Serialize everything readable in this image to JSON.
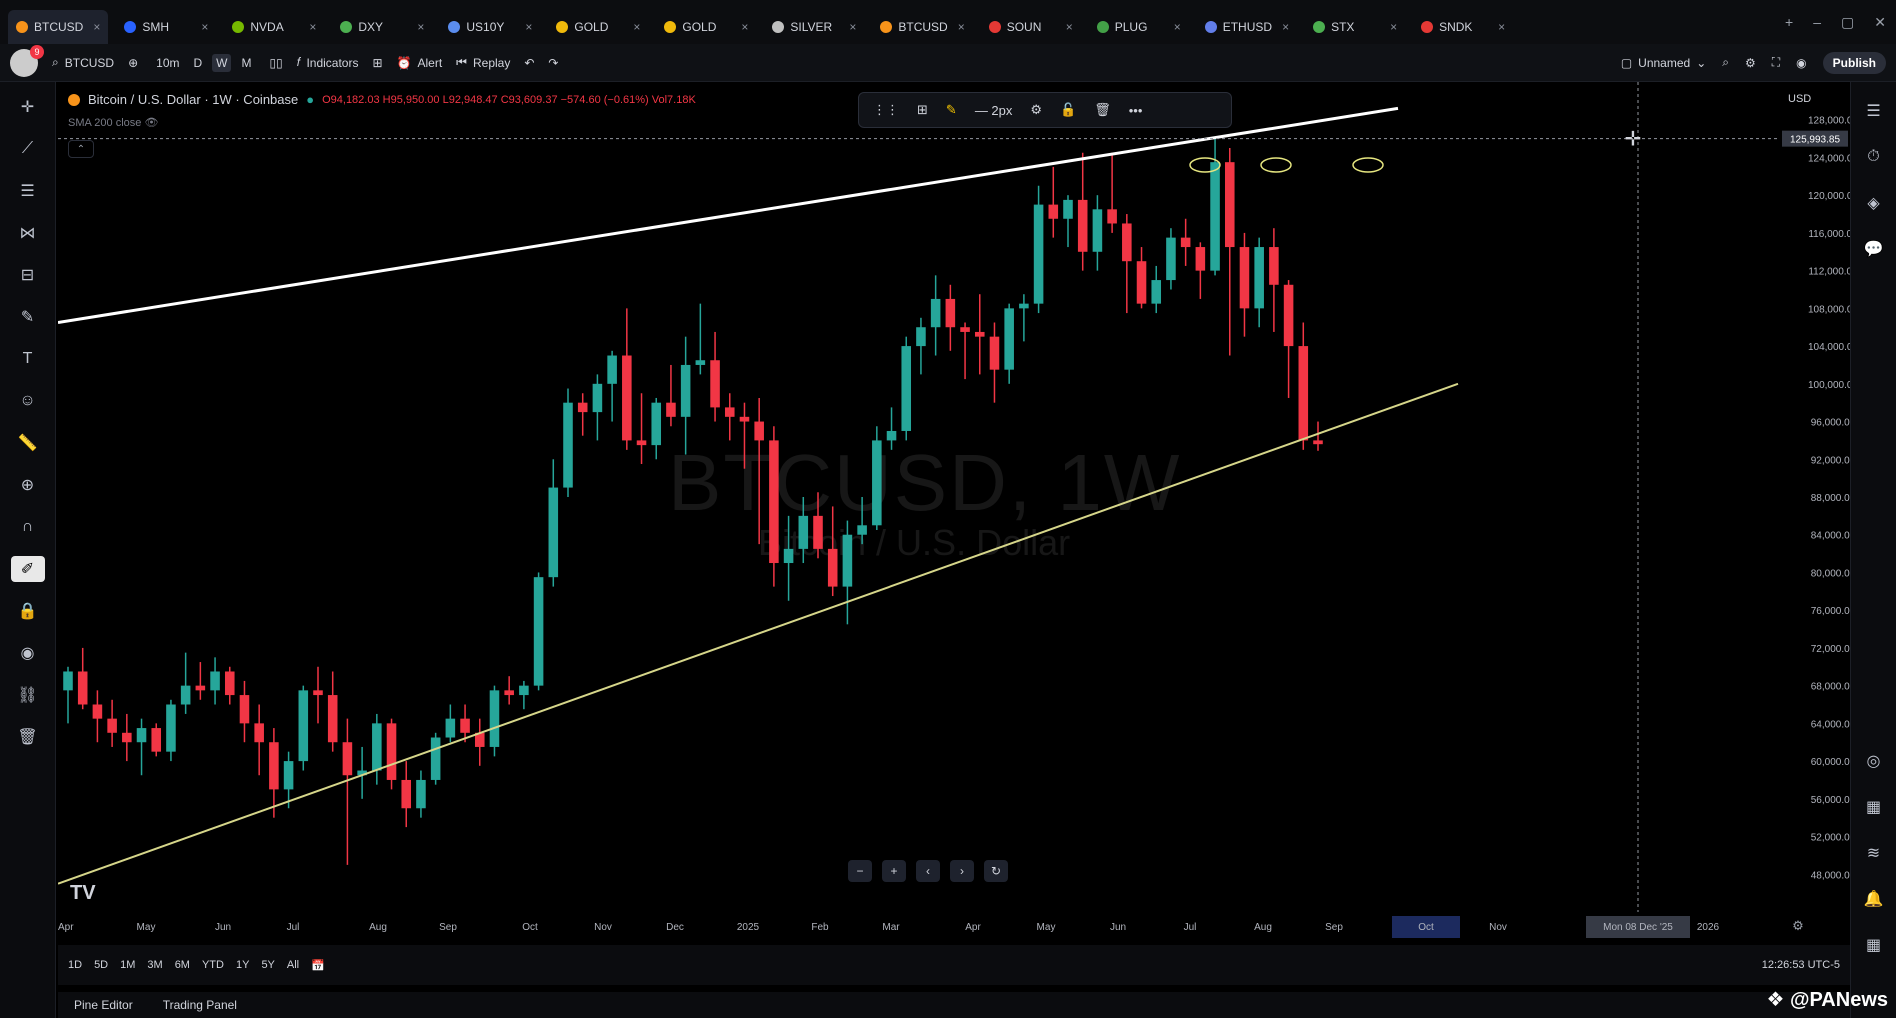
{
  "tabs": [
    {
      "label": "BTCUSD",
      "color": "#f7931a",
      "active": true
    },
    {
      "label": "SMH",
      "color": "#2962ff"
    },
    {
      "label": "NVDA",
      "color": "#76b900"
    },
    {
      "label": "DXY",
      "color": "#4caf50"
    },
    {
      "label": "US10Y",
      "color": "#5b8def"
    },
    {
      "label": "GOLD",
      "color": "#f0b90b"
    },
    {
      "label": "GOLD",
      "color": "#f0b90b"
    },
    {
      "label": "SILVER",
      "color": "#c0c0c0"
    },
    {
      "label": "BTCUSD",
      "color": "#f7931a"
    },
    {
      "label": "SOUN",
      "color": "#e53935"
    },
    {
      "label": "PLUG",
      "color": "#43a047"
    },
    {
      "label": "ETHUSD",
      "color": "#627eea"
    },
    {
      "label": "STX",
      "color": "#4caf50"
    },
    {
      "label": "SNDK",
      "color": "#e53935"
    }
  ],
  "toolbar": {
    "symbol": "BTCUSD",
    "intervals": [
      "10m",
      "D",
      "W",
      "M"
    ],
    "indicators": "Indicators",
    "alert": "Alert",
    "replay": "Replay",
    "layout_name": "Unnamed",
    "publish": "Publish"
  },
  "legend": {
    "title": "Bitcoin / U.S. Dollar · 1W · Coinbase",
    "ohlc": "O94,182.03 H95,950.00 L92,948.47 C93,609.37 −574.60 (−0.61%) Vol7.18K",
    "indicator": "SMA 200 close"
  },
  "watermark": {
    "main": "BTCUSD, 1W",
    "sub": "Bitcoin / U.S. Dollar"
  },
  "chart_data": {
    "type": "candlestick",
    "title": "Bitcoin / U.S. Dollar · 1W · Coinbase",
    "currency": "USD",
    "ylim": [
      44000,
      132000
    ],
    "yticks": [
      48000,
      52000,
      56000,
      60000,
      64000,
      68000,
      72000,
      76000,
      80000,
      84000,
      88000,
      92000,
      96000,
      100000,
      104000,
      108000,
      112000,
      116000,
      120000,
      124000,
      128000
    ],
    "ytick_labels": [
      "48,000.00",
      "52,000.00",
      "56,000.00",
      "60,000.00",
      "64,000.00",
      "68,000.00",
      "72,000.00",
      "76,000.00",
      "80,000.00",
      "84,000.00",
      "88,000.00",
      "92,000.00",
      "96,000.00",
      "100,000.00",
      "104,000.00",
      "108,000.00",
      "112,000.00",
      "116,000.00",
      "120,000.00",
      "124,000.00",
      "128,000.00"
    ],
    "crosshair_price": "125,993.85",
    "crosshair_price_value": 125993.85,
    "crosshair_date": "Mon 08 Dec '25",
    "xaxis_labels": [
      "Apr",
      "May",
      "Jun",
      "Jul",
      "Aug",
      "Sep",
      "Oct",
      "Nov",
      "Dec",
      "2025",
      "Feb",
      "Mar",
      "Apr",
      "May",
      "Jun",
      "Jul",
      "Aug",
      "Sep",
      "Oct",
      "Nov",
      "Mon 08 Dec '25",
      "2026"
    ],
    "highlighted_x_label": "Oct",
    "candles": [
      {
        "o": 67500,
        "h": 70000,
        "l": 64000,
        "c": 69500
      },
      {
        "o": 69500,
        "h": 72000,
        "l": 65500,
        "c": 66000
      },
      {
        "o": 66000,
        "h": 67500,
        "l": 62000,
        "c": 64500
      },
      {
        "o": 64500,
        "h": 66500,
        "l": 61500,
        "c": 63000
      },
      {
        "o": 63000,
        "h": 65000,
        "l": 60000,
        "c": 62000
      },
      {
        "o": 62000,
        "h": 64500,
        "l": 58500,
        "c": 63500
      },
      {
        "o": 63500,
        "h": 64000,
        "l": 60500,
        "c": 61000
      },
      {
        "o": 61000,
        "h": 66500,
        "l": 60000,
        "c": 66000
      },
      {
        "o": 66000,
        "h": 71500,
        "l": 65000,
        "c": 68000
      },
      {
        "o": 68000,
        "h": 70500,
        "l": 66500,
        "c": 67500
      },
      {
        "o": 67500,
        "h": 71000,
        "l": 66000,
        "c": 69500
      },
      {
        "o": 69500,
        "h": 70000,
        "l": 66000,
        "c": 67000
      },
      {
        "o": 67000,
        "h": 68500,
        "l": 62000,
        "c": 64000
      },
      {
        "o": 64000,
        "h": 66000,
        "l": 58500,
        "c": 62000
      },
      {
        "o": 62000,
        "h": 63500,
        "l": 54000,
        "c": 57000
      },
      {
        "o": 57000,
        "h": 61000,
        "l": 55000,
        "c": 60000
      },
      {
        "o": 60000,
        "h": 68000,
        "l": 59000,
        "c": 67500
      },
      {
        "o": 67500,
        "h": 70000,
        "l": 64000,
        "c": 67000
      },
      {
        "o": 67000,
        "h": 69500,
        "l": 61000,
        "c": 62000
      },
      {
        "o": 62000,
        "h": 64500,
        "l": 49000,
        "c": 58500
      },
      {
        "o": 58500,
        "h": 61500,
        "l": 56000,
        "c": 59000
      },
      {
        "o": 59000,
        "h": 65000,
        "l": 57500,
        "c": 64000
      },
      {
        "o": 64000,
        "h": 64500,
        "l": 57000,
        "c": 58000
      },
      {
        "o": 58000,
        "h": 60000,
        "l": 53000,
        "c": 55000
      },
      {
        "o": 55000,
        "h": 59000,
        "l": 54000,
        "c": 58000
      },
      {
        "o": 58000,
        "h": 63000,
        "l": 57500,
        "c": 62500
      },
      {
        "o": 62500,
        "h": 66000,
        "l": 62000,
        "c": 64500
      },
      {
        "o": 64500,
        "h": 66000,
        "l": 62000,
        "c": 63000
      },
      {
        "o": 63000,
        "h": 64500,
        "l": 59500,
        "c": 61500
      },
      {
        "o": 61500,
        "h": 68000,
        "l": 60500,
        "c": 67500
      },
      {
        "o": 67500,
        "h": 69000,
        "l": 66000,
        "c": 67000
      },
      {
        "o": 67000,
        "h": 68500,
        "l": 65500,
        "c": 68000
      },
      {
        "o": 68000,
        "h": 80000,
        "l": 67500,
        "c": 79500
      },
      {
        "o": 79500,
        "h": 92000,
        "l": 78500,
        "c": 89000
      },
      {
        "o": 89000,
        "h": 99500,
        "l": 88000,
        "c": 98000
      },
      {
        "o": 98000,
        "h": 99000,
        "l": 94500,
        "c": 97000
      },
      {
        "o": 97000,
        "h": 101000,
        "l": 94000,
        "c": 100000
      },
      {
        "o": 100000,
        "h": 103500,
        "l": 96000,
        "c": 103000
      },
      {
        "o": 103000,
        "h": 108000,
        "l": 93000,
        "c": 94000
      },
      {
        "o": 94000,
        "h": 99000,
        "l": 91500,
        "c": 93500
      },
      {
        "o": 93500,
        "h": 98500,
        "l": 92000,
        "c": 98000
      },
      {
        "o": 98000,
        "h": 102000,
        "l": 95500,
        "c": 96500
      },
      {
        "o": 96500,
        "h": 105000,
        "l": 92500,
        "c": 102000
      },
      {
        "o": 102000,
        "h": 108500,
        "l": 101000,
        "c": 102500
      },
      {
        "o": 102500,
        "h": 105500,
        "l": 96000,
        "c": 97500
      },
      {
        "o": 97500,
        "h": 99000,
        "l": 94000,
        "c": 96500
      },
      {
        "o": 96500,
        "h": 98000,
        "l": 91000,
        "c": 96000
      },
      {
        "o": 96000,
        "h": 98500,
        "l": 83000,
        "c": 94000
      },
      {
        "o": 94000,
        "h": 95500,
        "l": 78500,
        "c": 81000
      },
      {
        "o": 81000,
        "h": 86000,
        "l": 77000,
        "c": 82500
      },
      {
        "o": 82500,
        "h": 88000,
        "l": 81000,
        "c": 86000
      },
      {
        "o": 86000,
        "h": 88500,
        "l": 81500,
        "c": 82500
      },
      {
        "o": 82500,
        "h": 87000,
        "l": 77500,
        "c": 78500
      },
      {
        "o": 78500,
        "h": 85500,
        "l": 74500,
        "c": 84000
      },
      {
        "o": 84000,
        "h": 88000,
        "l": 83000,
        "c": 85000
      },
      {
        "o": 85000,
        "h": 95500,
        "l": 84500,
        "c": 94000
      },
      {
        "o": 94000,
        "h": 97500,
        "l": 93000,
        "c": 95000
      },
      {
        "o": 95000,
        "h": 105000,
        "l": 94000,
        "c": 104000
      },
      {
        "o": 104000,
        "h": 107000,
        "l": 101000,
        "c": 106000
      },
      {
        "o": 106000,
        "h": 111500,
        "l": 103000,
        "c": 109000
      },
      {
        "o": 109000,
        "h": 110500,
        "l": 103500,
        "c": 106000
      },
      {
        "o": 106000,
        "h": 106500,
        "l": 100500,
        "c": 105500
      },
      {
        "o": 105500,
        "h": 109500,
        "l": 101000,
        "c": 105000
      },
      {
        "o": 105000,
        "h": 106500,
        "l": 98000,
        "c": 101500
      },
      {
        "o": 101500,
        "h": 108500,
        "l": 100000,
        "c": 108000
      },
      {
        "o": 108000,
        "h": 109500,
        "l": 104500,
        "c": 108500
      },
      {
        "o": 108500,
        "h": 121000,
        "l": 107500,
        "c": 119000
      },
      {
        "o": 119000,
        "h": 123000,
        "l": 115500,
        "c": 117500
      },
      {
        "o": 117500,
        "h": 120000,
        "l": 114500,
        "c": 119500
      },
      {
        "o": 119500,
        "h": 124500,
        "l": 112000,
        "c": 114000
      },
      {
        "o": 114000,
        "h": 120000,
        "l": 112000,
        "c": 118500
      },
      {
        "o": 118500,
        "h": 124500,
        "l": 116000,
        "c": 117000
      },
      {
        "o": 117000,
        "h": 118000,
        "l": 107500,
        "c": 113000
      },
      {
        "o": 113000,
        "h": 114500,
        "l": 108000,
        "c": 108500
      },
      {
        "o": 108500,
        "h": 112500,
        "l": 107500,
        "c": 111000
      },
      {
        "o": 111000,
        "h": 116500,
        "l": 110000,
        "c": 115500
      },
      {
        "o": 115500,
        "h": 117500,
        "l": 112500,
        "c": 114500
      },
      {
        "o": 114500,
        "h": 115000,
        "l": 109000,
        "c": 112000
      },
      {
        "o": 112000,
        "h": 126000,
        "l": 111500,
        "c": 123500
      },
      {
        "o": 123500,
        "h": 125000,
        "l": 103000,
        "c": 114500
      },
      {
        "o": 114500,
        "h": 116000,
        "l": 105000,
        "c": 108000
      },
      {
        "o": 108000,
        "h": 115500,
        "l": 106000,
        "c": 114500
      },
      {
        "o": 114500,
        "h": 116500,
        "l": 105500,
        "c": 110500
      },
      {
        "o": 110500,
        "h": 111000,
        "l": 98500,
        "c": 104000
      },
      {
        "o": 104000,
        "h": 106500,
        "l": 93000,
        "c": 94000
      },
      {
        "o": 94000,
        "h": 96000,
        "l": 92900,
        "c": 93600
      }
    ],
    "trendlines": [
      {
        "name": "upper-resistance",
        "color": "#ffffff",
        "points": [
          [
            0,
            106500
          ],
          [
            1340,
            129200
          ]
        ]
      },
      {
        "name": "lower-support",
        "color": "#d6d68a",
        "points": [
          [
            0,
            47000
          ],
          [
            1400,
            100000
          ]
        ]
      }
    ],
    "colors": {
      "up": "#26a69a",
      "down": "#f23645",
      "upper_line": "#ffffff",
      "lower_line": "#d6d68a"
    }
  },
  "bottom": {
    "ranges": [
      "1D",
      "5D",
      "1M",
      "3M",
      "6M",
      "YTD",
      "1Y",
      "5Y",
      "All"
    ],
    "time": "12:26:53 UTC-5",
    "panels": [
      "Pine Editor",
      "Trading Panel"
    ],
    "brand": "@PANews"
  }
}
